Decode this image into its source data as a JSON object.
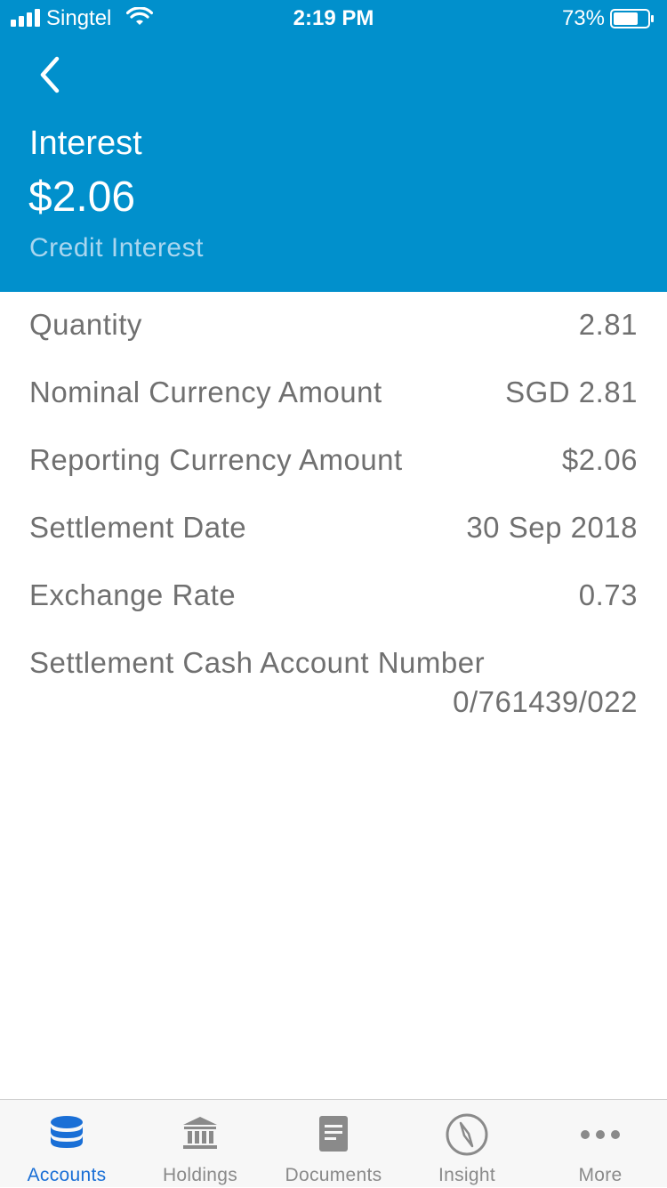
{
  "status_bar": {
    "carrier": "Singtel",
    "time": "2:19 PM",
    "battery_percent": "73%",
    "battery_level": 0.73
  },
  "header": {
    "back_icon": "chevron-left-icon",
    "title": "Interest",
    "amount": "$2.06",
    "subtitle": "Credit Interest"
  },
  "details": [
    {
      "label": "Quantity",
      "value": "2.81"
    },
    {
      "label": "Nominal Currency Amount",
      "value": "SGD 2.81"
    },
    {
      "label": "Reporting Currency Amount",
      "value": "$2.06"
    },
    {
      "label": "Settlement Date",
      "value": "30 Sep 2018"
    },
    {
      "label": "Exchange Rate",
      "value": "0.73"
    },
    {
      "label": "Settlement Cash Account Number",
      "value": "0/761439/022"
    }
  ],
  "tabs": [
    {
      "label": "Accounts",
      "icon": "database-icon",
      "active": true
    },
    {
      "label": "Holdings",
      "icon": "bank-icon",
      "active": false
    },
    {
      "label": "Documents",
      "icon": "document-icon",
      "active": false
    },
    {
      "label": "Insight",
      "icon": "compass-icon",
      "active": false
    },
    {
      "label": "More",
      "icon": "more-icon",
      "active": false
    }
  ],
  "colors": {
    "header_bg": "#0190cc",
    "active_tab": "#1a6fd6",
    "inactive_tab": "#8a8a8a",
    "detail_text": "#707070"
  }
}
